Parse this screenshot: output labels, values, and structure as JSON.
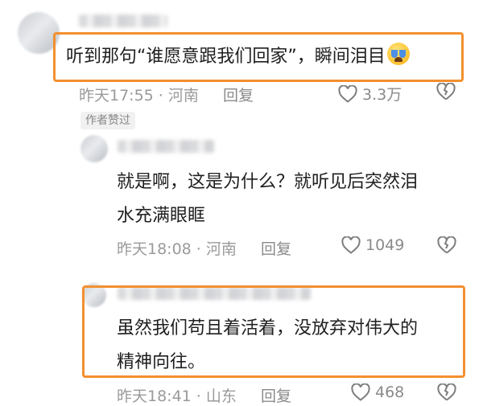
{
  "comments": [
    {
      "text": "听到那句“谁愿意跟我们回家”，瞬间泪目",
      "emoji_icon": "loudly-crying-face-icon",
      "time": "昨天17:55",
      "location": "河南",
      "reply": "回复",
      "likes": "3.3万",
      "badge": "作者赞过"
    },
    {
      "text": "就是啊，这是为什么？就听见后突然泪水充满眼眶",
      "line1": "就是啊，这是为什么？就听见后突然泪",
      "line2": "水充满眼眶",
      "time": "昨天18:08",
      "location": "河南",
      "reply": "回复",
      "likes": "1049"
    },
    {
      "text": "虽然我们苟且着活着，没放弃对伟大的精神向往。",
      "line1": "虽然我们苟且着活着，没放弃对伟大的",
      "line2": "精神向往。",
      "time": "昨天18:41",
      "location": "山东",
      "reply": "回复",
      "likes": "468"
    }
  ],
  "separator": " · ",
  "highlight_color": "#f2902f"
}
